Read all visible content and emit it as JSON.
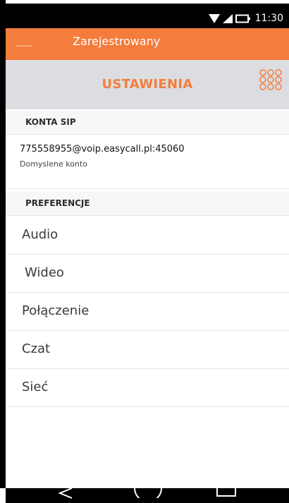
{
  "status_bar": {
    "time": "11:30",
    "icons": [
      "wifi-icon",
      "signal-icon",
      "battery-icon"
    ]
  },
  "registration": {
    "label": "Zarejestrowany",
    "color": "#f47c3c"
  },
  "header": {
    "title": "USTAWIENIA",
    "dialpad_icon": "dialpad-icon"
  },
  "sections": {
    "sip_accounts": "KONTA SIP",
    "preferences": "PREFERENCJE"
  },
  "account": {
    "address": "775558955@voip.easycall.pl:45060",
    "subtitle": "Domyslene konto"
  },
  "preferences": [
    {
      "label": "Audio"
    },
    {
      "label": "Wideo"
    },
    {
      "label": "Połączenie"
    },
    {
      "label": "Czat"
    },
    {
      "label": "Sieć"
    }
  ],
  "nav_bar": {
    "icons": [
      "back-icon",
      "home-icon",
      "recents-icon"
    ]
  }
}
